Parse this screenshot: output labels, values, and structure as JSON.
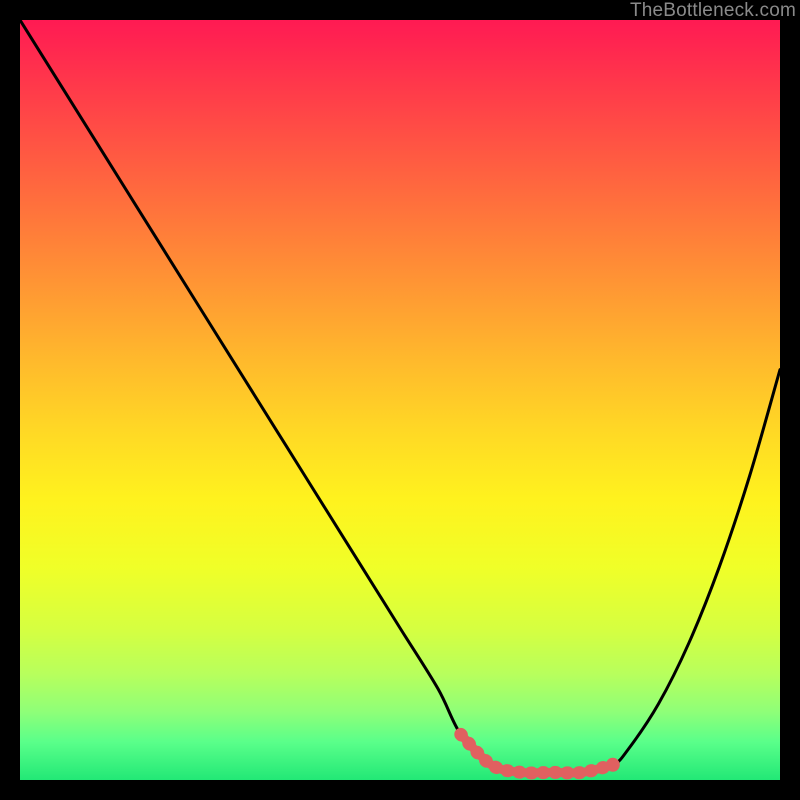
{
  "watermark": "TheBottleneck.com",
  "chart_data": {
    "type": "line",
    "title": "",
    "xlabel": "",
    "ylabel": "",
    "xlim": [
      0,
      100
    ],
    "ylim": [
      0,
      100
    ],
    "grid": false,
    "series": [
      {
        "name": "bottleneck-curve",
        "color": "#000000",
        "x": [
          0,
          5,
          10,
          15,
          20,
          25,
          30,
          35,
          40,
          45,
          50,
          55,
          58,
          62,
          66,
          70,
          74,
          78,
          80,
          84,
          88,
          92,
          96,
          100
        ],
        "y": [
          100,
          92,
          84,
          76,
          68,
          60,
          52,
          44,
          36,
          28,
          20,
          12,
          6,
          2,
          1,
          1,
          1,
          2,
          4,
          10,
          18,
          28,
          40,
          54
        ]
      },
      {
        "name": "basin-highlight",
        "color": "#e06060",
        "x": [
          58,
          62,
          66,
          70,
          74,
          78
        ],
        "y": [
          6,
          2,
          1,
          1,
          1,
          2
        ]
      }
    ],
    "markers": [
      {
        "name": "basin-dot",
        "x": 78,
        "y": 2,
        "color": "#e06060"
      }
    ],
    "gradient_stops": [
      {
        "pct": 0,
        "color": "#ff1a53"
      },
      {
        "pct": 9,
        "color": "#ff3a4a"
      },
      {
        "pct": 18,
        "color": "#ff5a42"
      },
      {
        "pct": 27,
        "color": "#ff7a3a"
      },
      {
        "pct": 36,
        "color": "#ff9a33"
      },
      {
        "pct": 45,
        "color": "#ffba2c"
      },
      {
        "pct": 54,
        "color": "#ffd825"
      },
      {
        "pct": 63,
        "color": "#fff21e"
      },
      {
        "pct": 72,
        "color": "#f0ff28"
      },
      {
        "pct": 80,
        "color": "#d6ff40"
      },
      {
        "pct": 86,
        "color": "#b8ff5c"
      },
      {
        "pct": 91,
        "color": "#8fff78"
      },
      {
        "pct": 95,
        "color": "#5aff8a"
      },
      {
        "pct": 100,
        "color": "#22e876"
      }
    ]
  }
}
